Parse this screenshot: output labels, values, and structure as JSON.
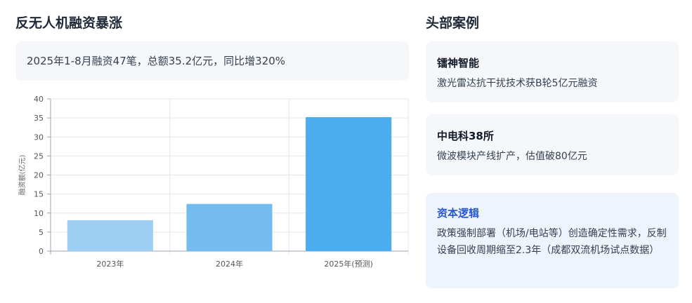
{
  "left_title": "反无人机融资暴涨",
  "summary": "2025年1-8月融资47笔，总额35.2亿元，同比增320%",
  "chart_data": {
    "type": "bar",
    "categories": [
      "2023年",
      "2024年",
      "2025年(预测)"
    ],
    "values": [
      8.1,
      12.4,
      35.2
    ],
    "ylabel": "融资额(亿元)",
    "ylim": [
      0,
      40
    ],
    "yticks": [
      0,
      5,
      10,
      15,
      20,
      25,
      30,
      35,
      40
    ],
    "grid": true,
    "bar_colors": [
      "#9dcff5",
      "#74bbf0",
      "#4badee"
    ]
  },
  "right_title": "头部案例",
  "cases": [
    {
      "title": "镭神智能",
      "text": "激光雷达抗干扰技术获B轮5亿元融资"
    },
    {
      "title": "中电科38所",
      "text": "微波模块产线扩产，估值破80亿元"
    },
    {
      "title": "资本逻辑",
      "text": "政策强制部署（机场/电站等）创造确定性需求，反制设备回收周期缩至2.3年（成都双流机场试点数据）"
    }
  ]
}
